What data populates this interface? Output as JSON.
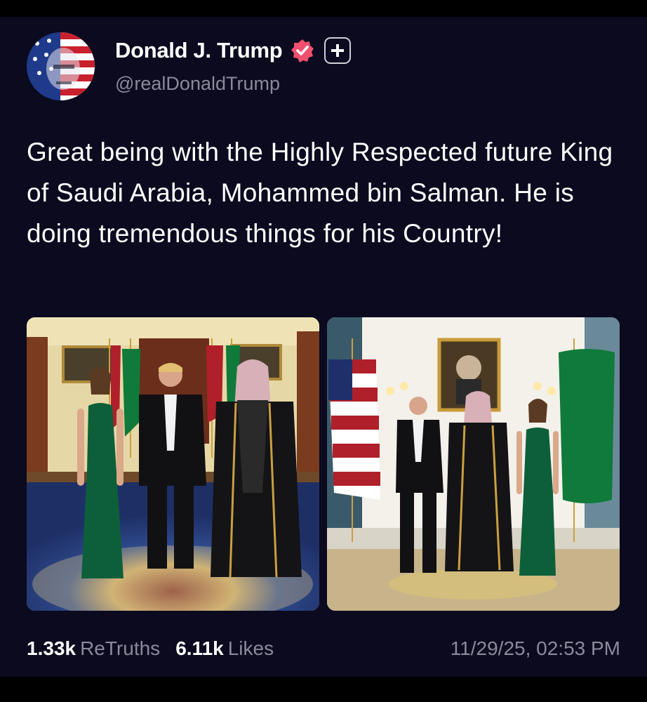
{
  "post": {
    "author_name": "Donald J. Trump",
    "handle": "@realDonaldTrump",
    "text": "Great being with the Highly Respected future King of Saudi Arabia, Mohammed bin Salman. He is doing tremendous things for his Country!",
    "retruths_count": "1.33k",
    "retruths_label": "ReTruths",
    "likes_count": "6.11k",
    "likes_label": "Likes",
    "timestamp": "11/29/25, 02:53 PM"
  },
  "icons": {
    "verified": "verified-badge-icon",
    "follow": "plus-icon"
  },
  "colors": {
    "background": "#0b0a1f",
    "verified_badge": "#f0506e",
    "muted_text": "#8a8a9a"
  }
}
